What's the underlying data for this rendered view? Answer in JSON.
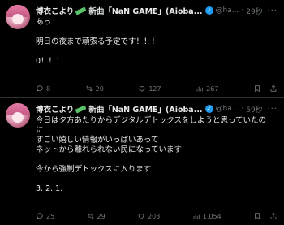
{
  "tweets": [
    {
      "name": "博衣こより",
      "name_suffix": "新曲「NaN GAME」(Aioba...",
      "handle": "@ha...",
      "time": "29秒",
      "lines": [
        "あっ",
        "",
        "明日の夜まで頑張る予定です！！！",
        "",
        "0！！！"
      ],
      "stats": {
        "replies": "8",
        "retweets": "20",
        "likes": "127",
        "views": "267"
      }
    },
    {
      "name": "博衣こより",
      "name_suffix": "新曲「NaN GAME」(Aioba...",
      "handle": "@ha...",
      "time": "59秒",
      "lines": [
        "今日は夕方あたりからデジタルデトックスをしようと思っていたの",
        "に",
        "すごい嬉しい情報がいっぱいあって",
        "ネットから離れられない民になっています",
        "",
        "今から強制デトックスに入ります",
        "",
        "3. 2. 1."
      ],
      "stats": {
        "replies": "25",
        "retweets": "29",
        "likes": "203",
        "views": "1,054"
      }
    }
  ],
  "icons": {
    "verified": "verified-check-icon",
    "more": "more-icon",
    "reply": "reply-icon",
    "retweet": "retweet-icon",
    "like": "heart-icon",
    "views": "views-icon",
    "bookmark": "bookmark-icon",
    "share": "share-icon"
  },
  "colors": {
    "background": "#000000",
    "text": "#e7e9ea",
    "muted": "#71767b",
    "verified": "#1d9bf0"
  }
}
